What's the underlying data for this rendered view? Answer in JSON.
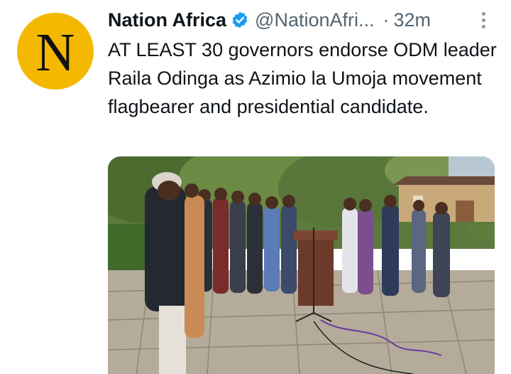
{
  "tweet": {
    "avatar_letter": "N",
    "display_name": "Nation Africa",
    "handle": "@NationAfri...",
    "separator": "·",
    "time": "32m",
    "text": "AT LEAST 30 governors endorse ODM leader Raila Odinga as Azimio la Umoja movement flagbearer and presidential candidate.",
    "media_alt": "Photo of governors standing behind a podium with microphones outdoors"
  },
  "colors": {
    "avatar_bg": "#f5b800",
    "verified": "#1d9bf0",
    "secondary_text": "#536471"
  },
  "icons": {
    "verified": "verified-badge-icon",
    "more": "more-options-icon"
  }
}
